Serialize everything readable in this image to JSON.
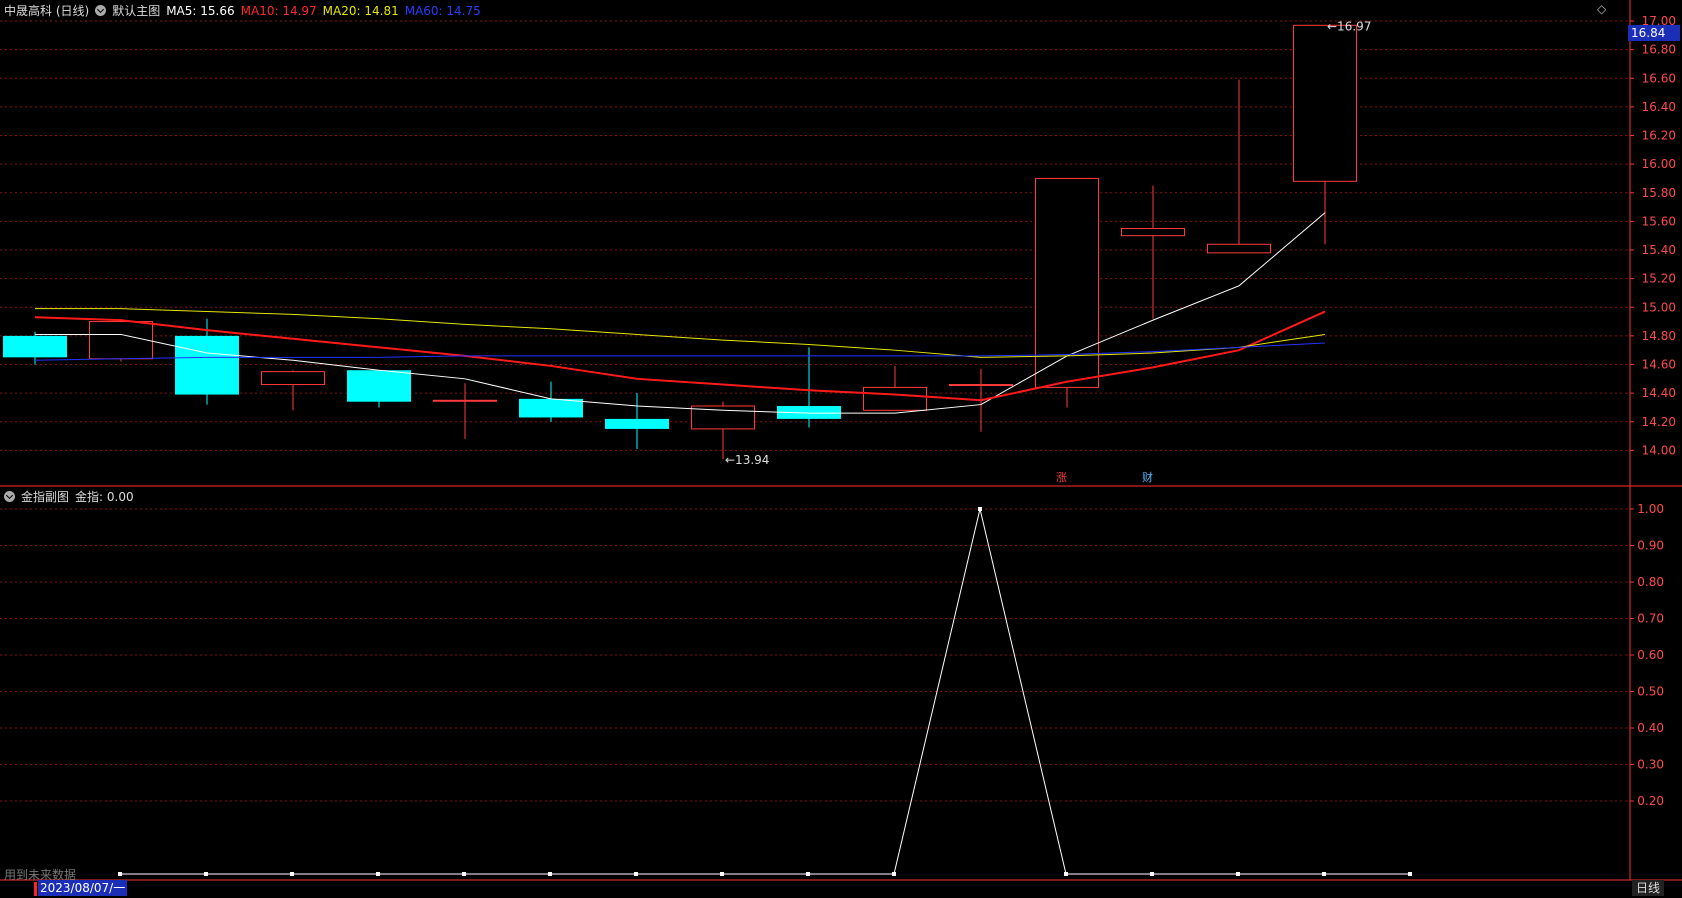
{
  "main_header": {
    "symbol": "中晟高科 (日线)",
    "template": "默认主图",
    "ma5": "MA5: 15.66",
    "ma10": "MA10: 14.97",
    "ma20": "MA20: 14.81",
    "ma60": "MA60: 14.75"
  },
  "sub_header": {
    "title": "金指副图",
    "value": "金指: 0.00"
  },
  "colors": {
    "up": "#ff3b3b",
    "down": "#00ffff",
    "ma5": "#ffffff",
    "ma10": "#ff1a1a",
    "ma20": "#e6e600",
    "ma60": "#2233ff",
    "grid": "#8a1010",
    "axis": "#ff3030"
  },
  "current_price_label": "16.84",
  "badges": {
    "zhang": "涨",
    "cai": "财"
  },
  "status_text": "用到未来数据",
  "date_label": "2023/08/07/一",
  "period_button": "日线",
  "chart_data": [
    {
      "type": "candlestick",
      "title": "中晟高科 (日线)",
      "ylim": [
        13.8,
        17.0
      ],
      "y_ticks": [
        "17.00",
        "16.80",
        "16.60",
        "16.40",
        "16.20",
        "16.00",
        "15.80",
        "15.60",
        "15.40",
        "15.20",
        "15.00",
        "14.80",
        "14.60",
        "14.40",
        "14.20",
        "14.00"
      ],
      "candles": [
        {
          "open": 14.8,
          "close": 14.65,
          "high": 14.83,
          "low": 14.6
        },
        {
          "open": 14.64,
          "close": 14.9,
          "high": 14.91,
          "low": 14.62
        },
        {
          "open": 14.8,
          "close": 14.39,
          "high": 14.92,
          "low": 14.32
        },
        {
          "open": 14.46,
          "close": 14.55,
          "high": 14.56,
          "low": 14.28
        },
        {
          "open": 14.56,
          "close": 14.34,
          "high": 14.56,
          "low": 14.3
        },
        {
          "open": 14.35,
          "close": 14.35,
          "high": 14.47,
          "low": 14.08
        },
        {
          "open": 14.36,
          "close": 14.23,
          "high": 14.48,
          "low": 14.2
        },
        {
          "open": 14.22,
          "close": 14.15,
          "high": 14.4,
          "low": 14.01
        },
        {
          "open": 14.15,
          "close": 14.31,
          "high": 14.34,
          "low": 13.94
        },
        {
          "open": 14.31,
          "close": 14.22,
          "high": 14.72,
          "low": 14.16
        },
        {
          "open": 14.28,
          "close": 14.44,
          "high": 14.59,
          "low": 14.28
        },
        {
          "open": 14.46,
          "close": 14.46,
          "high": 14.57,
          "low": 14.13
        },
        {
          "open": 14.44,
          "close": 15.9,
          "high": 15.9,
          "low": 14.3
        },
        {
          "open": 15.5,
          "close": 15.55,
          "high": 15.85,
          "low": 14.92
        },
        {
          "open": 15.38,
          "close": 15.44,
          "high": 16.59,
          "low": 15.38
        },
        {
          "open": 15.88,
          "close": 16.97,
          "high": 16.97,
          "low": 15.44
        }
      ],
      "series": [
        {
          "name": "MA5",
          "values": [
            14.81,
            14.81,
            14.68,
            14.63,
            14.56,
            14.5,
            14.36,
            14.31,
            14.28,
            14.26,
            14.26,
            14.32,
            14.66,
            14.91,
            15.15,
            15.66
          ]
        },
        {
          "name": "MA10",
          "values": [
            14.93,
            14.91,
            14.84,
            14.78,
            14.72,
            14.66,
            14.59,
            14.5,
            14.46,
            14.42,
            14.39,
            14.35,
            14.48,
            14.58,
            14.7,
            14.97
          ]
        },
        {
          "name": "MA20",
          "values": [
            14.99,
            14.99,
            14.97,
            14.95,
            14.92,
            14.88,
            14.85,
            14.81,
            14.77,
            14.74,
            14.7,
            14.65,
            14.66,
            14.68,
            14.72,
            14.81
          ]
        },
        {
          "name": "MA60",
          "values": [
            14.63,
            14.64,
            14.65,
            14.65,
            14.65,
            14.66,
            14.66,
            14.66,
            14.66,
            14.66,
            14.66,
            14.66,
            14.67,
            14.69,
            14.72,
            14.75
          ]
        }
      ],
      "annotations": [
        {
          "label": "16.97",
          "candle": 15,
          "value": 16.97
        },
        {
          "label": "13.94",
          "candle": 8,
          "value": 13.94
        }
      ]
    },
    {
      "type": "line",
      "title": "金指副图",
      "ylim": [
        0.0,
        1.05
      ],
      "y_ticks": [
        "1.00",
        "0.90",
        "0.80",
        "0.70",
        "0.60",
        "0.50",
        "0.40",
        "0.30",
        "0.20"
      ],
      "series": [
        {
          "name": "金指",
          "values": [
            0,
            0,
            0,
            0,
            0,
            0,
            0,
            0,
            0,
            0,
            1.0,
            0,
            0,
            0,
            0,
            0
          ]
        }
      ]
    }
  ]
}
